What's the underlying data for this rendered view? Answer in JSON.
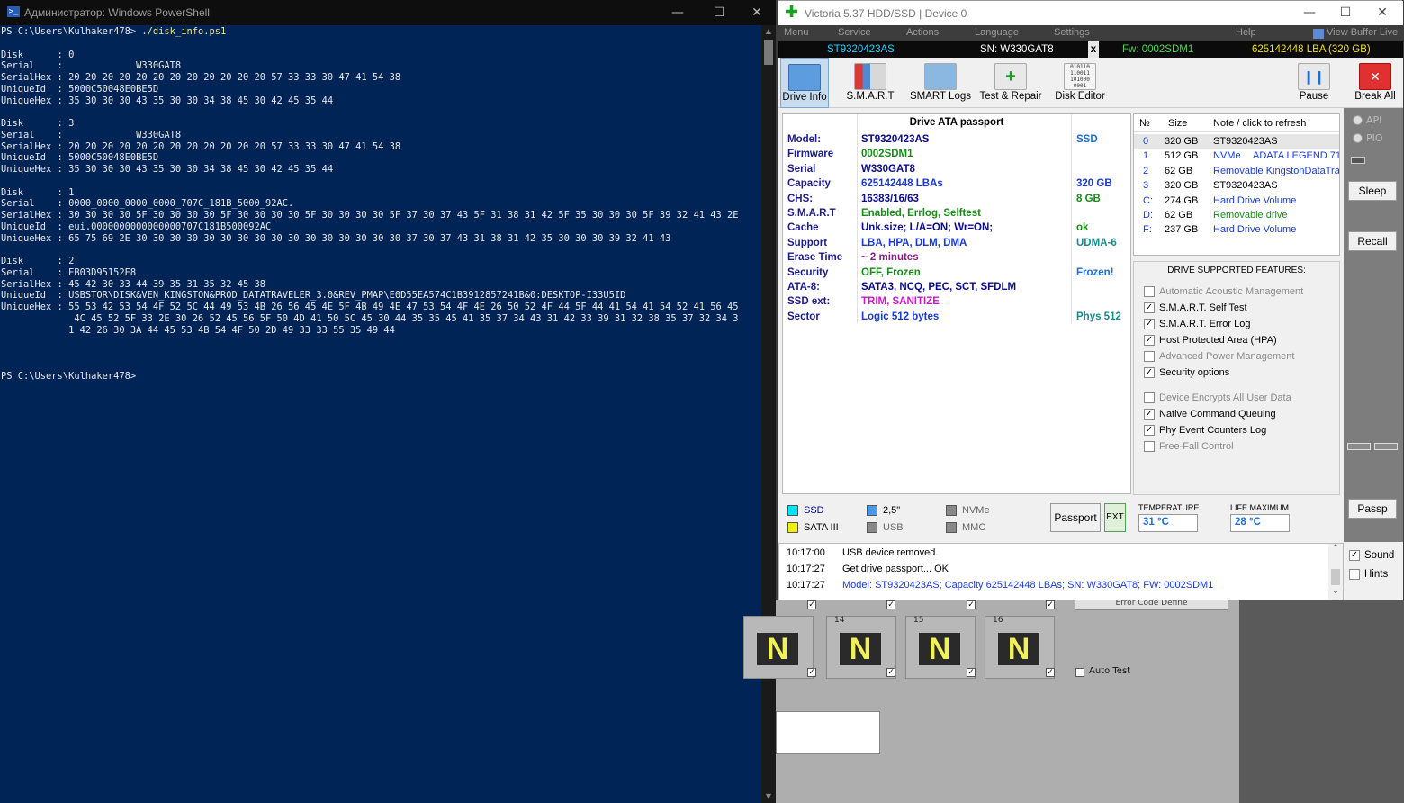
{
  "powershell": {
    "title": "Администратор: Windows PowerShell",
    "prompt1": "PS C:\\Users\\Kulhaker478> ",
    "command": "./disk_info.ps1",
    "output": "\n\nDisk      : 0\nSerial    :             W330GAT8\nSerialHex : 20 20 20 20 20 20 20 20 20 20 20 20 57 33 33 30 47 41 54 38\nUniqueId  : 5000C50048E0BE5D\nUniqueHex : 35 30 30 30 43 35 30 30 34 38 45 30 42 45 35 44\n\nDisk      : 3\nSerial    :             W330GAT8\nSerialHex : 20 20 20 20 20 20 20 20 20 20 20 20 57 33 33 30 47 41 54 38\nUniqueId  : 5000C50048E0BE5D\nUniqueHex : 35 30 30 30 43 35 30 30 34 38 45 30 42 45 35 44\n\nDisk      : 1\nSerial    : 0000_0000_0000_0000_707C_181B_5000_92AC.\nSerialHex : 30 30 30 30 5F 30 30 30 30 5F 30 30 30 30 5F 30 30 30 30 5F 37 30 37 43 5F 31 38 31 42 5F 35 30 30 30 5F 39 32 41 43 2E\nUniqueId  : eui.0000000000000000707C181B500092AC\nUniqueHex : 65 75 69 2E 30 30 30 30 30 30 30 30 30 30 30 30 30 30 30 30 37 30 37 43 31 38 31 42 35 30 30 30 39 32 41 43\n\nDisk      : 2\nSerial    : EB03D95152E8\nSerialHex : 45 42 30 33 44 39 35 31 35 32 45 38\nUniqueId  : USBSTOR\\DISK&VEN_KINGSTON&PROD_DATATRAVELER_3.0&REV_PMAP\\E0D55EA574C1B3912857241B&0:DESKTOP-I33U5ID\nUniqueHex : 55 53 42 53 54 4F 52 5C 44 49 53 4B 26 56 45 4E 5F 4B 49 4E 47 53 54 4F 4E 26 50 52 4F 44 5F 44 41 54 41 54 52 41 56 45\n             4C 45 52 5F 33 2E 30 26 52 45 56 5F 50 4D 41 50 5C 45 30 44 35 35 45 41 35 37 34 43 31 42 33 39 31 32 38 35 37 32 34 3\n            1 42 26 30 3A 44 45 53 4B 54 4F 50 2D 49 33 33 55 35 49 44\n\n\n\n",
    "prompt2": "PS C:\\Users\\Kulhaker478>"
  },
  "victoria": {
    "title": "Victoria 5.37 HDD/SSD | Device 0",
    "menu": [
      "Menu",
      "Service",
      "Actions",
      "Language",
      "Settings",
      "Help",
      "View Buffer Live"
    ],
    "infobar": {
      "model": "ST9320423AS",
      "sn": "SN: W330GAT8",
      "x": "x",
      "fw": "Fw: 0002SDM1",
      "lba": "625142448 LBA (320 GB)"
    },
    "toolbar": [
      "Drive Info",
      "S.M.A.R.T",
      "SMART Logs",
      "Test & Repair",
      "Disk Editor",
      "Pause",
      "Break All"
    ],
    "passport_title": "Drive ATA passport",
    "passport": [
      {
        "k": "Model:",
        "v": "ST9320423AS",
        "x": "SSD",
        "vc": "#0a0a8a",
        "xc": "#1a6ed4"
      },
      {
        "k": "Firmware",
        "v": "0002SDM1",
        "x": "",
        "vc": "#1a8a1a",
        "xc": "#000"
      },
      {
        "k": "Serial",
        "v": "W330GAT8",
        "x": "",
        "vc": "#0a0a8a",
        "xc": "#000"
      },
      {
        "k": "Capacity",
        "v": "625142448 LBAs",
        "x": "320 GB",
        "vc": "#1a3ad4",
        "xc": "#1a3ad4"
      },
      {
        "k": "CHS:",
        "v": "16383/16/63",
        "x": "8 GB",
        "vc": "#0a0a8a",
        "xc": "#1a8a1a"
      },
      {
        "k": "S.M.A.R.T",
        "v": "Enabled, Errlog, Selftest",
        "x": "",
        "vc": "#1a8a1a",
        "xc": "#000"
      },
      {
        "k": "Cache",
        "v": "Unk.size; L/A=ON; Wr=ON;",
        "x": "ok",
        "vc": "#0a0a8a",
        "xc": "#1a8a1a"
      },
      {
        "k": "Support",
        "v": "LBA, HPA, DLM, DMA",
        "x": "UDMA-6",
        "vc": "#1a3ad4",
        "xc": "#1a8a8a"
      },
      {
        "k": "Erase Time",
        "v": "~ 2 minutes",
        "x": "",
        "vc": "#8a1a8a",
        "xc": "#000"
      },
      {
        "k": "Security",
        "v": "OFF, Frozen",
        "x": "Frozen!",
        "vc": "#1a8a1a",
        "xc": "#1a6ed4"
      },
      {
        "k": "ATA-8:",
        "v": "SATA3, NCQ, PEC, SCT, SFDLM",
        "x": "",
        "vc": "#0a0a8a",
        "xc": "#000"
      },
      {
        "k": "SSD ext:",
        "v": "TRIM, SANITIZE",
        "x": "",
        "vc": "#c81ac8",
        "xc": "#000"
      },
      {
        "k": "Sector",
        "v": "Logic 512 bytes",
        "x": "Phys 512",
        "vc": "#1a3ad4",
        "xc": "#1a8a8a"
      }
    ],
    "drive_list_headers": [
      "№",
      "Size",
      "Note / click to refresh"
    ],
    "drives": [
      {
        "n": "0",
        "size": "320 GB",
        "note": "ST9320423AS",
        "note2": "",
        "nc": "#000"
      },
      {
        "n": "1",
        "size": "512 GB",
        "note": "NVMe",
        "note2": "ADATA LEGEND 71",
        "nc": "#1a3ad4"
      },
      {
        "n": "2",
        "size": "62 GB",
        "note": "Removable KingstonDataTra",
        "note2": "",
        "nc": "#1a3ad4"
      },
      {
        "n": "3",
        "size": "320 GB",
        "note": "ST9320423AS",
        "note2": "",
        "nc": "#000"
      },
      {
        "n": "C:",
        "size": "274 GB",
        "note": "Hard Drive Volume",
        "note2": "",
        "nc": "#1a3ad4"
      },
      {
        "n": "D:",
        "size": "62 GB",
        "note": "Removable drive",
        "note2": "",
        "nc": "#1a8a1a"
      },
      {
        "n": "F:",
        "size": "237 GB",
        "note": "Hard Drive Volume",
        "note2": "",
        "nc": "#1a3ad4"
      }
    ],
    "features_title": "DRIVE SUPPORTED FEATURES:",
    "features": [
      {
        "t": "Automatic Acoustic Management",
        "on": false
      },
      {
        "t": "S.M.A.R.T. Self Test",
        "on": true
      },
      {
        "t": "S.M.A.R.T. Error Log",
        "on": true
      },
      {
        "t": "Host Protected Area (HPA)",
        "on": true
      },
      {
        "t": "Advanced Power Management",
        "on": false
      },
      {
        "t": "Security options",
        "on": true
      },
      {
        "t": "Device Encrypts All User Data",
        "on": false
      },
      {
        "t": "Native Command Queuing",
        "on": true
      },
      {
        "t": "Phy Event Counters Log",
        "on": true
      },
      {
        "t": "Free-Fall Control",
        "on": false
      }
    ],
    "side": {
      "api": "API",
      "pio": "PIO",
      "sleep": "Sleep",
      "recall": "Recall",
      "passp": "Passp"
    },
    "legend": [
      {
        "t": "SSD",
        "c": "#00e5ff",
        "tc": "#0a0a8a"
      },
      {
        "t": "2,5\"",
        "c": "#4a9ae8",
        "tc": "#000"
      },
      {
        "t": "NVMe",
        "c": "#888888",
        "tc": "#666"
      },
      {
        "t": "SATA III",
        "c": "#f0f000",
        "tc": "#000"
      },
      {
        "t": "USB",
        "c": "#888888",
        "tc": "#666"
      },
      {
        "t": "MMC",
        "c": "#888888",
        "tc": "#666"
      }
    ],
    "passport_btn": "Passport",
    "ext_btn": "EXT",
    "temperature_label": "TEMPERATURE",
    "temperature": "31 °C",
    "life_label": "LIFE MAXIMUM",
    "life": "28 °C",
    "log": [
      {
        "tm": "10:17:00",
        "m": "USB device removed.",
        "c": "#000"
      },
      {
        "tm": "10:17:27",
        "m": "Get drive passport... OK",
        "c": "#000"
      },
      {
        "tm": "10:17:27",
        "m": "Model: ST9320423AS; Capacity 625142448 LBAs; SN: W330GAT8; FW: 0002SDM1",
        "c": "#1a3ad4"
      }
    ],
    "sound": "Sound",
    "hints": "Hints"
  },
  "background": {
    "boxes": [
      "14",
      "15",
      "16"
    ],
    "auto_test": "Auto Test",
    "error_code": "Error Code Define"
  }
}
